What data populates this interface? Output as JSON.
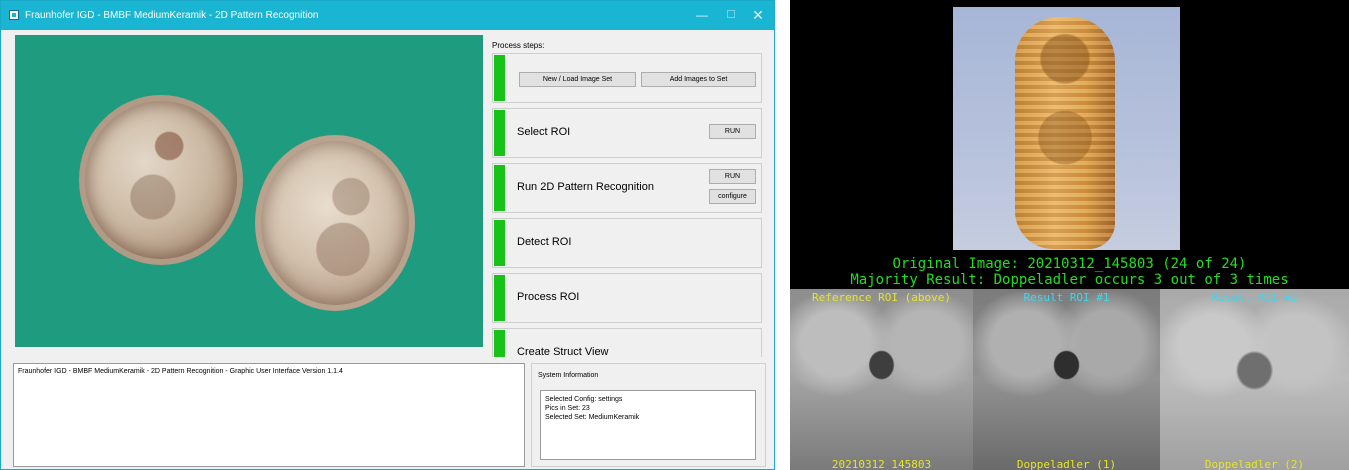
{
  "app": {
    "title": "Fraunhofer IGD - BMBF MediumKeramik - 2D Pattern Recognition",
    "window_controls": {
      "minimize": "—",
      "maximize": "☐",
      "close": "✕"
    }
  },
  "process": {
    "label": "Process steps:",
    "steps": [
      {
        "title": "",
        "buttons": [
          "New / Load Image Set",
          "Add Images to Set"
        ]
      },
      {
        "title": "Select ROI",
        "buttons": [
          "RUN"
        ]
      },
      {
        "title": "Run 2D Pattern Recognition",
        "buttons": [
          "RUN",
          "configure"
        ]
      },
      {
        "title": "Detect ROI",
        "buttons": []
      },
      {
        "title": "Process ROI",
        "buttons": []
      },
      {
        "title": "Create Struct View",
        "buttons": []
      }
    ]
  },
  "log": {
    "text": "Fraunhofer IGD - BMBF MediumKeramik - 2D Pattern Recognition - Graphic User Interface Version 1.1.4"
  },
  "system_info": {
    "label": "System Information",
    "lines": [
      "Selected Config: settings",
      "Pics in Set: 23",
      "Selected Set: MediumKeramik"
    ]
  },
  "result": {
    "line1": "Original Image: 20210312_145803 (24 of 24)",
    "line2": "Majority Result: Doppeladler occurs 3 out of 3 times",
    "roi_labels": [
      "Reference ROI (above)",
      "Result ROI #1",
      "Result ROI #2"
    ],
    "roi_bottom_labels": [
      "20210312_145803",
      "Doppeladler (1)",
      "Doppeladler (2)"
    ],
    "colors": {
      "overlay": "#22dd22",
      "reference_label": "#e5e52a",
      "result_label": "#3fd7ee"
    }
  }
}
